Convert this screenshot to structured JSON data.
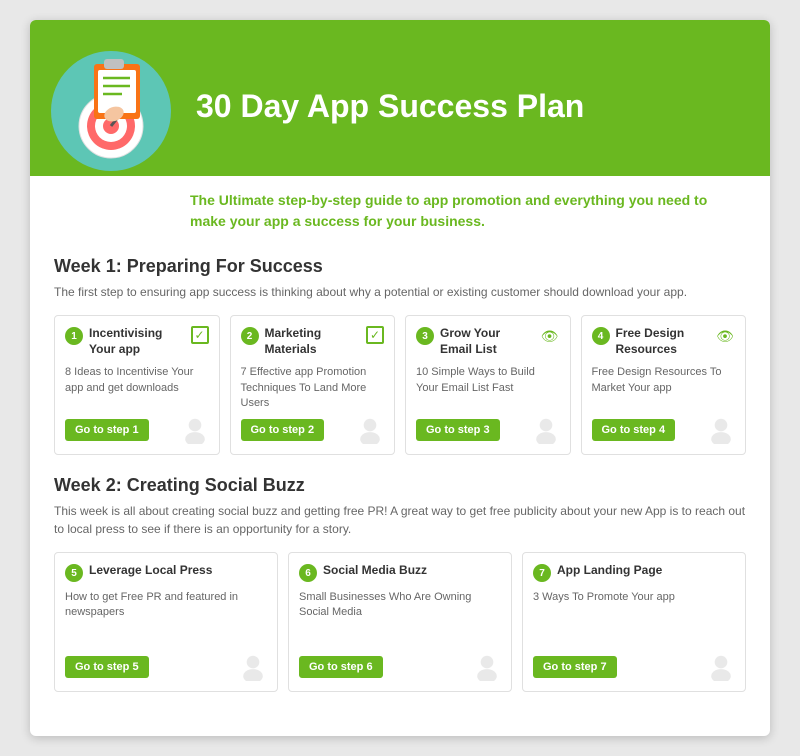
{
  "header": {
    "title": "30 Day App Success Plan",
    "subtitle": "The Ultimate step-by-step guide to app promotion and everything you need to make your app a success for your business."
  },
  "weeks": [
    {
      "label": "Week 1:",
      "title": "Preparing For Success",
      "description": "The first step to ensuring app success is thinking about why a potential or existing customer should download your app.",
      "cards": [
        {
          "step": "1",
          "title": "Incentivising Your app",
          "badge": "check",
          "description": "8 Ideas to Incentivise Your app and get downloads",
          "button": "Go to step 1"
        },
        {
          "step": "2",
          "title": "Marketing Materials",
          "badge": "check",
          "description": "7 Effective app Promotion Techniques To Land More Users",
          "button": "Go to step 2"
        },
        {
          "step": "3",
          "title": "Grow Your Email List",
          "badge": "eye",
          "description": "10 Simple Ways to Build Your Email List Fast",
          "button": "Go to step 3"
        },
        {
          "step": "4",
          "title": "Free Design Resources",
          "badge": "eye",
          "description": "Free Design Resources To Market Your app",
          "button": "Go to step 4"
        }
      ]
    },
    {
      "label": "Week 2:",
      "title": "Creating Social Buzz",
      "description": "This week is all about creating social buzz and getting free PR! A great way to get free publicity about your new App is to reach out to local press to see if there is an opportunity for a story.",
      "cards": [
        {
          "step": "5",
          "title": "Leverage Local Press",
          "badge": "none",
          "description": "How to get Free PR and featured in newspapers",
          "button": "Go to step 5"
        },
        {
          "step": "6",
          "title": "Social Media Buzz",
          "badge": "none",
          "description": "Small Businesses Who Are Owning Social Media",
          "button": "Go to step 6"
        },
        {
          "step": "7",
          "title": "App Landing Page",
          "badge": "none",
          "description": "3 Ways To Promote Your app",
          "button": "Go to step 7"
        }
      ]
    }
  ],
  "colors": {
    "green": "#6ab820"
  }
}
